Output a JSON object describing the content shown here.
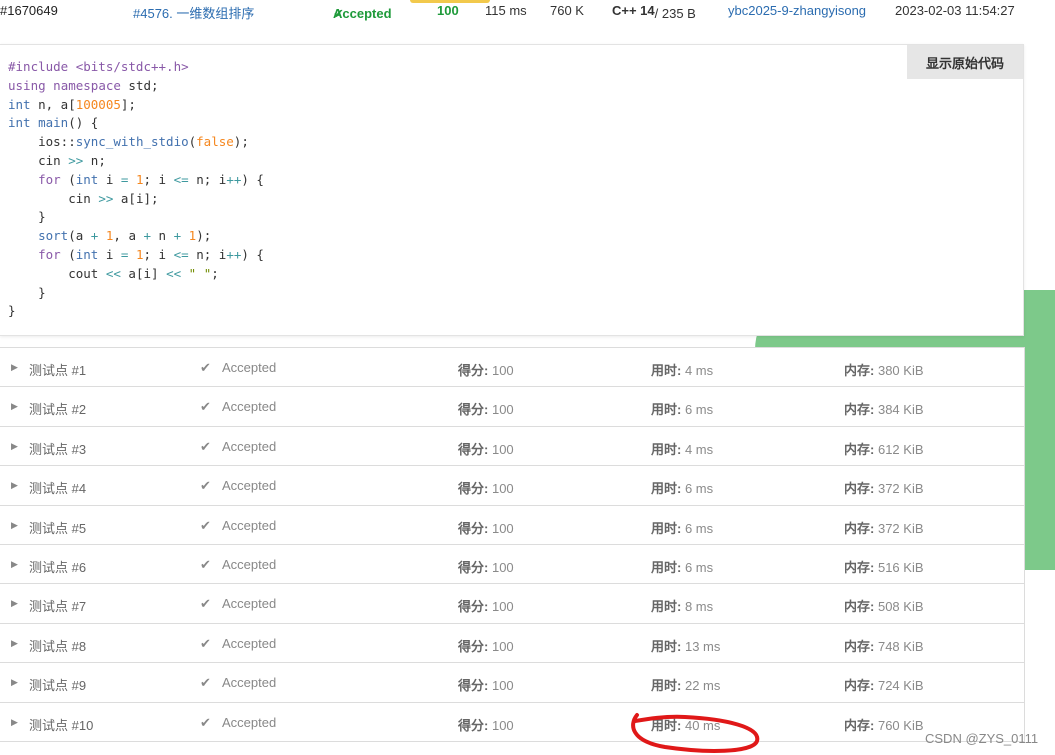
{
  "submission": {
    "id": "#1670649",
    "problem": "#4576. 一维数组排序",
    "status": "Accepted",
    "score": "100",
    "time": "115 ms",
    "memory": "760 K",
    "language": "C++ 14",
    "code_size": "/ 235 B",
    "user": "ybc2025-9-zhangyisong",
    "submitted_at": "2023-02-03 11:54:27",
    "status_color": "#1e9a3a",
    "link_color": "#2b6cb0"
  },
  "code_panel": {
    "show_raw_label": "显示原始代码",
    "lines": [
      "#include <bits/stdc++.h>",
      "using namespace std;",
      "int n, a[100005];",
      "int main() {",
      "    ios::sync_with_stdio(false);",
      "    cin >> n;",
      "    for (int i = 1; i <= n; i++) {",
      "        cin >> a[i];",
      "    }",
      "    sort(a + 1, a + n + 1);",
      "    for (int i = 1; i <= n; i++) {",
      "        cout << a[i] << \" \";",
      "    }",
      "}"
    ]
  },
  "labels": {
    "score": "得分:",
    "time": "用时:",
    "memory": "内存:"
  },
  "test_cases": [
    {
      "name": "测试点 #1",
      "status": "Accepted",
      "score": "100",
      "time": "4 ms",
      "memory": "380 KiB"
    },
    {
      "name": "测试点 #2",
      "status": "Accepted",
      "score": "100",
      "time": "6 ms",
      "memory": "384 KiB"
    },
    {
      "name": "测试点 #3",
      "status": "Accepted",
      "score": "100",
      "time": "4 ms",
      "memory": "612 KiB"
    },
    {
      "name": "测试点 #4",
      "status": "Accepted",
      "score": "100",
      "time": "6 ms",
      "memory": "372 KiB"
    },
    {
      "name": "测试点 #5",
      "status": "Accepted",
      "score": "100",
      "time": "6 ms",
      "memory": "372 KiB"
    },
    {
      "name": "测试点 #6",
      "status": "Accepted",
      "score": "100",
      "time": "6 ms",
      "memory": "516 KiB"
    },
    {
      "name": "测试点 #7",
      "status": "Accepted",
      "score": "100",
      "time": "8 ms",
      "memory": "508 KiB"
    },
    {
      "name": "测试点 #8",
      "status": "Accepted",
      "score": "100",
      "time": "13 ms",
      "memory": "748 KiB"
    },
    {
      "name": "测试点 #9",
      "status": "Accepted",
      "score": "100",
      "time": "22 ms",
      "memory": "724 KiB"
    },
    {
      "name": "测试点 #10",
      "status": "Accepted",
      "score": "100",
      "time": "40 ms",
      "memory": "760 KiB"
    }
  ],
  "icons": {
    "status_check": "check-icon",
    "row_toggle": "caret-right-icon"
  },
  "watermark": "CSDN @ZYS_0111"
}
